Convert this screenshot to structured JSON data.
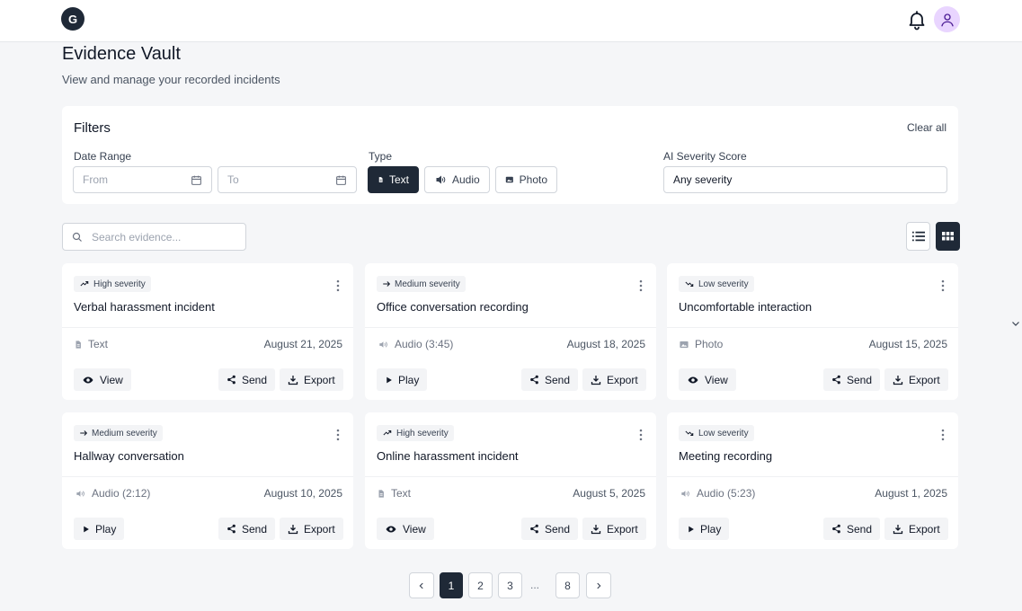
{
  "header": {
    "logo_letter": "G",
    "icons": [
      "bell-icon",
      "user-icon"
    ]
  },
  "page": {
    "title": "Evidence Vault",
    "subtitle": "View and manage your recorded incidents"
  },
  "filters": {
    "title": "Filters",
    "clear_all": "Clear all",
    "date_range_label": "Date Range",
    "from_placeholder": "From",
    "to_placeholder": "To",
    "type_label": "Type",
    "types": [
      {
        "label": "Text",
        "icon": "document-icon",
        "active": true
      },
      {
        "label": "Audio",
        "icon": "speaker-icon",
        "active": false
      },
      {
        "label": "Photo",
        "icon": "image-icon",
        "active": false
      }
    ],
    "severity_label": "AI Severity Score",
    "severity_value": "Any severity"
  },
  "search": {
    "placeholder": "Search evidence..."
  },
  "cards": [
    {
      "severity": "High severity",
      "severity_icon": "trend-up-icon",
      "title": "Verbal harassment incident",
      "type": "Text",
      "type_icon": "document-icon",
      "date": "August 21, 2025",
      "primary": "View",
      "send": "Send",
      "export": "Export"
    },
    {
      "severity": "Medium severity",
      "severity_icon": "arrow-right-icon",
      "title": "Office conversation recording",
      "type": "Audio (3:45)",
      "type_icon": "speaker-icon",
      "date": "August 18, 2025",
      "primary": "Play",
      "send": "Send",
      "export": "Export"
    },
    {
      "severity": "Low severity",
      "severity_icon": "trend-down-icon",
      "title": "Uncomfortable interaction",
      "type": "Photo",
      "type_icon": "image-icon",
      "date": "August 15, 2025",
      "primary": "View",
      "send": "Send",
      "export": "Export"
    },
    {
      "severity": "Medium severity",
      "severity_icon": "arrow-right-icon",
      "title": "Hallway conversation",
      "type": "Audio (2:12)",
      "type_icon": "speaker-icon",
      "date": "August 10, 2025",
      "primary": "Play",
      "send": "Send",
      "export": "Export"
    },
    {
      "severity": "High severity",
      "severity_icon": "trend-up-icon",
      "title": "Online harassment incident",
      "type": "Text",
      "type_icon": "document-icon",
      "date": "August 5, 2025",
      "primary": "View",
      "send": "Send",
      "export": "Export"
    },
    {
      "severity": "Low severity",
      "severity_icon": "trend-down-icon",
      "title": "Meeting recording",
      "type": "Audio (5:23)",
      "type_icon": "speaker-icon",
      "date": "August 1, 2025",
      "primary": "Play",
      "send": "Send",
      "export": "Export"
    }
  ],
  "pagination": {
    "pages": [
      "1",
      "2",
      "3",
      "8"
    ],
    "current": "1",
    "ellipsis": "..."
  },
  "colors": {
    "primary_dark": "#1f2937",
    "background": "#f5f6f8",
    "avatar_bg": "#e9d5ff"
  }
}
